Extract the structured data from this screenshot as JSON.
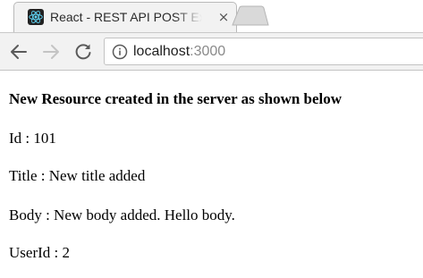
{
  "browser": {
    "tab": {
      "title": "React - REST API POST Ex",
      "close_glyph": "×",
      "favicon": "react-logo-icon"
    },
    "toolbar": {
      "back_icon": "arrow-left-icon",
      "forward_icon": "arrow-right-icon",
      "reload_icon": "reload-icon",
      "info_icon": "info-circle-icon"
    },
    "address": {
      "host": "localhost",
      "port": ":3000"
    }
  },
  "page": {
    "heading": "New Resource created in the server as shown below",
    "fields": {
      "id": "Id : 101",
      "title": "Title : New title added",
      "body": "Body : New body added. Hello body.",
      "user_id": "UserId : 2"
    }
  },
  "colors": {
    "chrome_bg": "#f2f2f2",
    "react_blue": "#61dafb",
    "text": "#000000",
    "port_gray": "#8a8a8a"
  }
}
